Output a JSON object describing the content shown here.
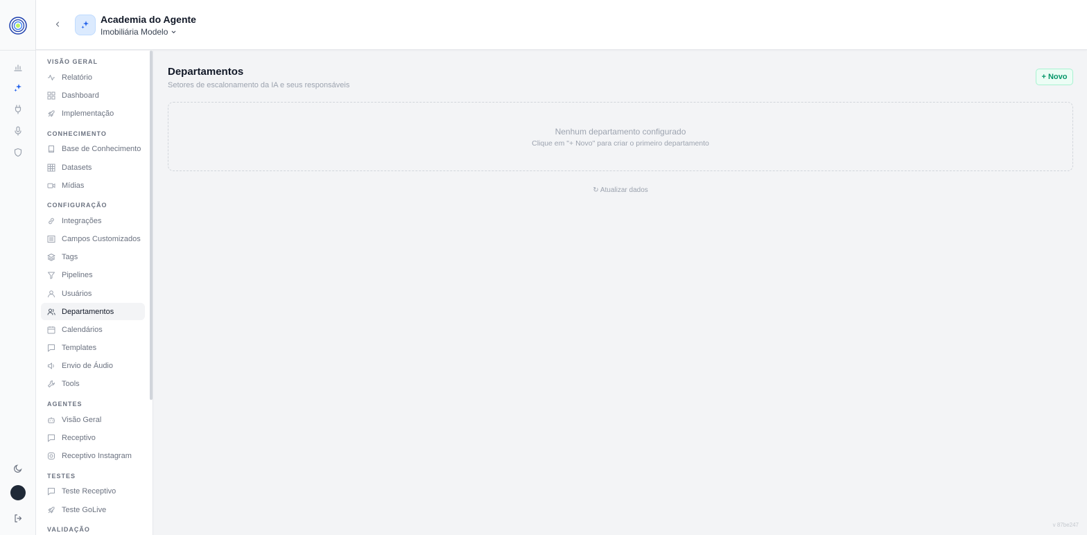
{
  "header": {
    "agent_name": "Academia do Agente",
    "workspace_name": "Imobiliária Modelo"
  },
  "sidebar": {
    "sections": [
      {
        "title": "VISÃO GERAL",
        "items": [
          "Relatório",
          "Dashboard",
          "Implementação"
        ]
      },
      {
        "title": "CONHECIMENTO",
        "items": [
          "Base de Conhecimento",
          "Datasets",
          "Mídias"
        ]
      },
      {
        "title": "CONFIGURAÇÃO",
        "items": [
          "Integrações",
          "Campos Customizados",
          "Tags",
          "Pipelines",
          "Usuários",
          "Departamentos",
          "Calendários",
          "Templates",
          "Envio de Áudio",
          "Tools"
        ]
      },
      {
        "title": "AGENTES",
        "items": [
          "Visão Geral",
          "Receptivo",
          "Receptivo Instagram"
        ]
      },
      {
        "title": "TESTES",
        "items": [
          "Teste Receptivo",
          "Teste GoLive"
        ]
      },
      {
        "title": "VALIDAÇÃO",
        "items": []
      }
    ],
    "active_item": "Departamentos"
  },
  "main": {
    "title": "Departamentos",
    "subtitle": "Setores de escalonamento da IA e seus responsáveis",
    "new_button": "+ Novo",
    "empty_title": "Nenhum departamento configurado",
    "empty_hint": "Clique em \"+ Novo\" para criar o primeiro departamento",
    "refresh_label": "↻ Atualizar dados"
  },
  "version": "v 87be247",
  "icons": {
    "rail": [
      "chart-bar-icon",
      "sparkles-icon",
      "plug-icon",
      "microphone-icon",
      "shield-icon",
      "moon-icon",
      "logout-icon"
    ]
  },
  "colors": {
    "accent_blue": "#2563eb",
    "new_button_green": "#059669",
    "logo_lime": "#bef264"
  }
}
